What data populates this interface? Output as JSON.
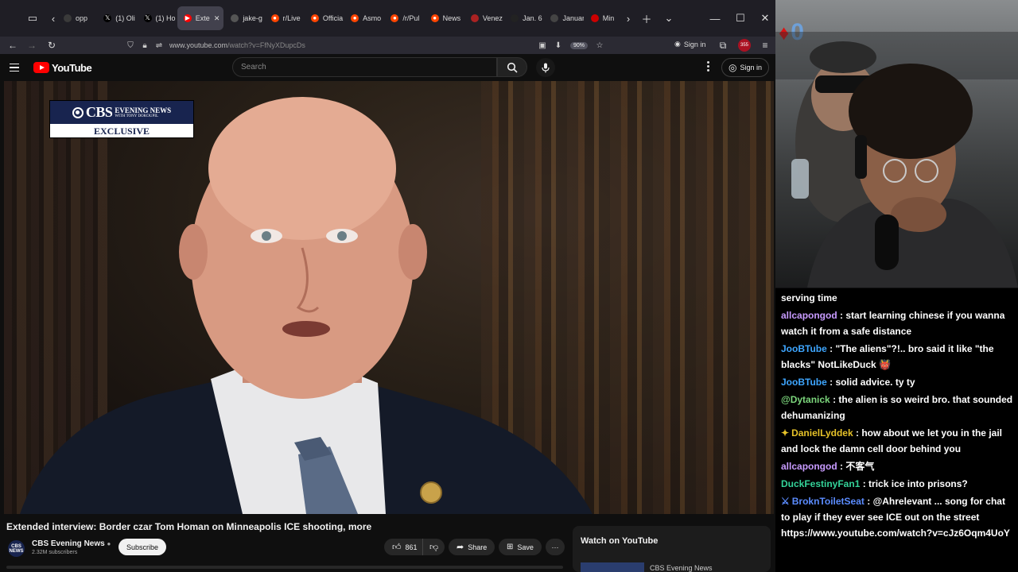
{
  "browser": {
    "tabs": [
      {
        "label": "opp",
        "color": "#3a3a3a",
        "glyph": "",
        "active": false
      },
      {
        "label": "(1) Oli",
        "color": "#000000",
        "glyph": "𝕏",
        "active": false
      },
      {
        "label": "(1) Ho",
        "color": "#000000",
        "glyph": "𝕏",
        "active": false
      },
      {
        "label": "Exte",
        "color": "#ff0000",
        "glyph": "▶",
        "active": true
      },
      {
        "label": "jake-g",
        "color": "#555555",
        "glyph": "",
        "active": false
      },
      {
        "label": "r/Live",
        "color": "#ff4500",
        "glyph": "●",
        "active": false
      },
      {
        "label": "Officia",
        "color": "#ff4500",
        "glyph": "●",
        "active": false
      },
      {
        "label": "Asmo",
        "color": "#ff4500",
        "glyph": "●",
        "active": false
      },
      {
        "label": "/r/Pul",
        "color": "#ff4500",
        "glyph": "●",
        "active": false
      },
      {
        "label": "News",
        "color": "#ff4500",
        "glyph": "●",
        "active": false
      },
      {
        "label": "Venez",
        "color": "#aa2222",
        "glyph": "",
        "active": false
      },
      {
        "label": "Jan. 6",
        "color": "#222222",
        "glyph": "",
        "active": false
      },
      {
        "label": "Januar",
        "color": "#444444",
        "glyph": "",
        "active": false
      },
      {
        "label": "Min",
        "color": "#cc0000",
        "glyph": "",
        "active": false
      }
    ],
    "url_prefix": "www.youtube.com",
    "url_path": "/watch?v=FfNyXDupcDs",
    "zoom": "90%",
    "signin_label": "Sign in",
    "ext_count": "355"
  },
  "youtube": {
    "logo_text": "YouTube",
    "search_placeholder": "Search",
    "signin_label": "Sign in",
    "badge": {
      "brand": "CBS",
      "line1": "EVENING NEWS",
      "line2": "WITH TONY DOKOUPIL",
      "line3": "EXCLUSIVE"
    },
    "video_title": "Extended interview: Border czar Tom Homan on Minneapolis ICE shooting, more",
    "channel": {
      "avatar_text": "CBS NEWS",
      "name": "CBS Evening News",
      "subscribers": "2.32M subscribers",
      "subscribe_label": "Subscribe"
    },
    "likes": "861",
    "share_label": "Share",
    "save_label": "Save",
    "watch_on_youtube": "Watch on YouTube",
    "related_channel": "CBS Evening News"
  },
  "stream": {
    "overlay_count": "0",
    "chat": [
      {
        "user": "",
        "user_color": "#ffffff",
        "badge": "",
        "text": "serving time"
      },
      {
        "user": "allcapongod",
        "user_color": "#c89bff",
        "badge": "",
        "text": "start learning chinese if you wanna watch it from a safe distance"
      },
      {
        "user": "JooBTube",
        "user_color": "#3ea6ff",
        "badge": "",
        "text": "\"The aliens\"?!.. bro said it like \"the blacks\" NotLikeDuck 👹"
      },
      {
        "user": "JooBTube",
        "user_color": "#3ea6ff",
        "badge": "",
        "text": "solid advice. ty ty"
      },
      {
        "user": "@Dytanick",
        "user_color": "#7cd67c",
        "badge": "",
        "text": "the alien is so weird bro. that sounded dehumanizing"
      },
      {
        "user": "DanielLyddek",
        "user_color": "#e6c229",
        "badge": "✦",
        "text": "how about we let you in the jail and lock the damn cell door behind you"
      },
      {
        "user": "allcapongod",
        "user_color": "#c89bff",
        "badge": "",
        "text": "不客气"
      },
      {
        "user": "DuckFestinyFan1",
        "user_color": "#34d399",
        "badge": "",
        "text": "trick ice into prisons?"
      },
      {
        "user": "BroknToiletSeat",
        "user_color": "#5b8cff",
        "badge": "⚔",
        "text": "@Ahrelevant ... song for chat to play if they ever see ICE out on the street https://www.youtube.com/watch?v=cJz6Oqm4UoY"
      }
    ]
  }
}
